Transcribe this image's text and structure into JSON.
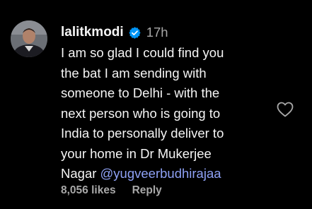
{
  "comment": {
    "username": "lalitkmodi",
    "verified_icon": "verified-badge-icon",
    "time": "17h",
    "lines": [
      "I am so glad I could find you",
      "the bat I am sending with",
      "someone to Delhi - with the",
      "next person who is going to",
      "India to personally deliver to",
      "your home in Dr Mukerjee",
      "Nagar "
    ],
    "mention": "@yugveerbudhirajaa",
    "likes": "8,056 likes",
    "reply": "Reply",
    "like_icon": "heart-outline-icon",
    "avatar_icon": "avatar"
  },
  "colors": {
    "background": "#000000",
    "text": "#f5f5f5",
    "secondary": "#a8a8a8",
    "mention": "#8ea1f5",
    "verified": "#0095f6"
  }
}
